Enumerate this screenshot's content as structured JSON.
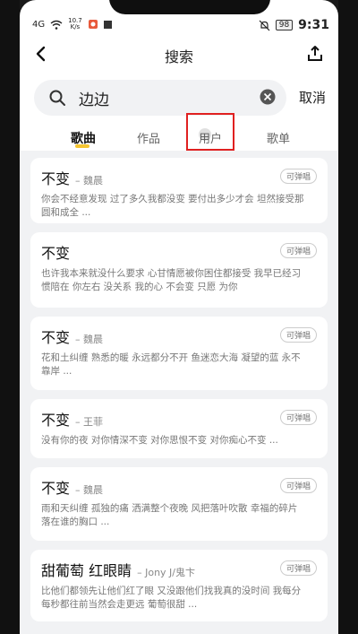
{
  "status": {
    "sim": "4G",
    "speed_value": "10.7",
    "speed_unit": "K/s",
    "battery": "98",
    "time": "9:31"
  },
  "header": {
    "title": "搜索"
  },
  "search": {
    "query": "边边",
    "cancel_label": "取消"
  },
  "tabs": [
    {
      "label": "歌曲",
      "active": true
    },
    {
      "label": "作品",
      "active": false
    },
    {
      "label": "用户",
      "active": false
    },
    {
      "label": "歌单",
      "active": false
    }
  ],
  "results": [
    {
      "title": "不变",
      "artist": "– 魏晨",
      "badge": "可弹唱",
      "lyrics": "你会不经意发现 过了多久我都没变 要付出多少才会 坦然接受那圆和成全 ..."
    },
    {
      "title": "不变",
      "artist": "",
      "badge": "可弹唱",
      "lyrics": "也许我本来就没什么要求 心甘情愿被你困住都接受 我早已经习惯陪在 你左右 没关系 我的心 不会变 只愿 为你"
    },
    {
      "title": "不变",
      "artist": "– 魏晨",
      "badge": "可弹唱",
      "lyrics": "花和土纠缠 熟悉的暖 永远都分不开 鱼迷恋大海 凝望的蓝 永不靠岸 ..."
    },
    {
      "title": "不变",
      "artist": "– 王菲",
      "badge": "可弹唱",
      "lyrics": "没有你的夜 对你情深不变 对你思恨不变 对你痴心不变 ..."
    },
    {
      "title": "不变",
      "artist": "– 魏晨",
      "badge": "可弹唱",
      "lyrics": "雨和天纠缠 孤独的痛 洒满整个夜晚 风把落叶吹散 幸福的碎片 落在谁的胸口 ..."
    },
    {
      "title": "甜葡萄 红眼睛",
      "artist": "– Jony J/鬼卞",
      "badge": "可弹唱",
      "lyrics": "比他们都领先让他们红了眼 又没跟他们找我真的没时间 我每分每秒都往前当然会走更远 葡萄很甜 ..."
    }
  ]
}
